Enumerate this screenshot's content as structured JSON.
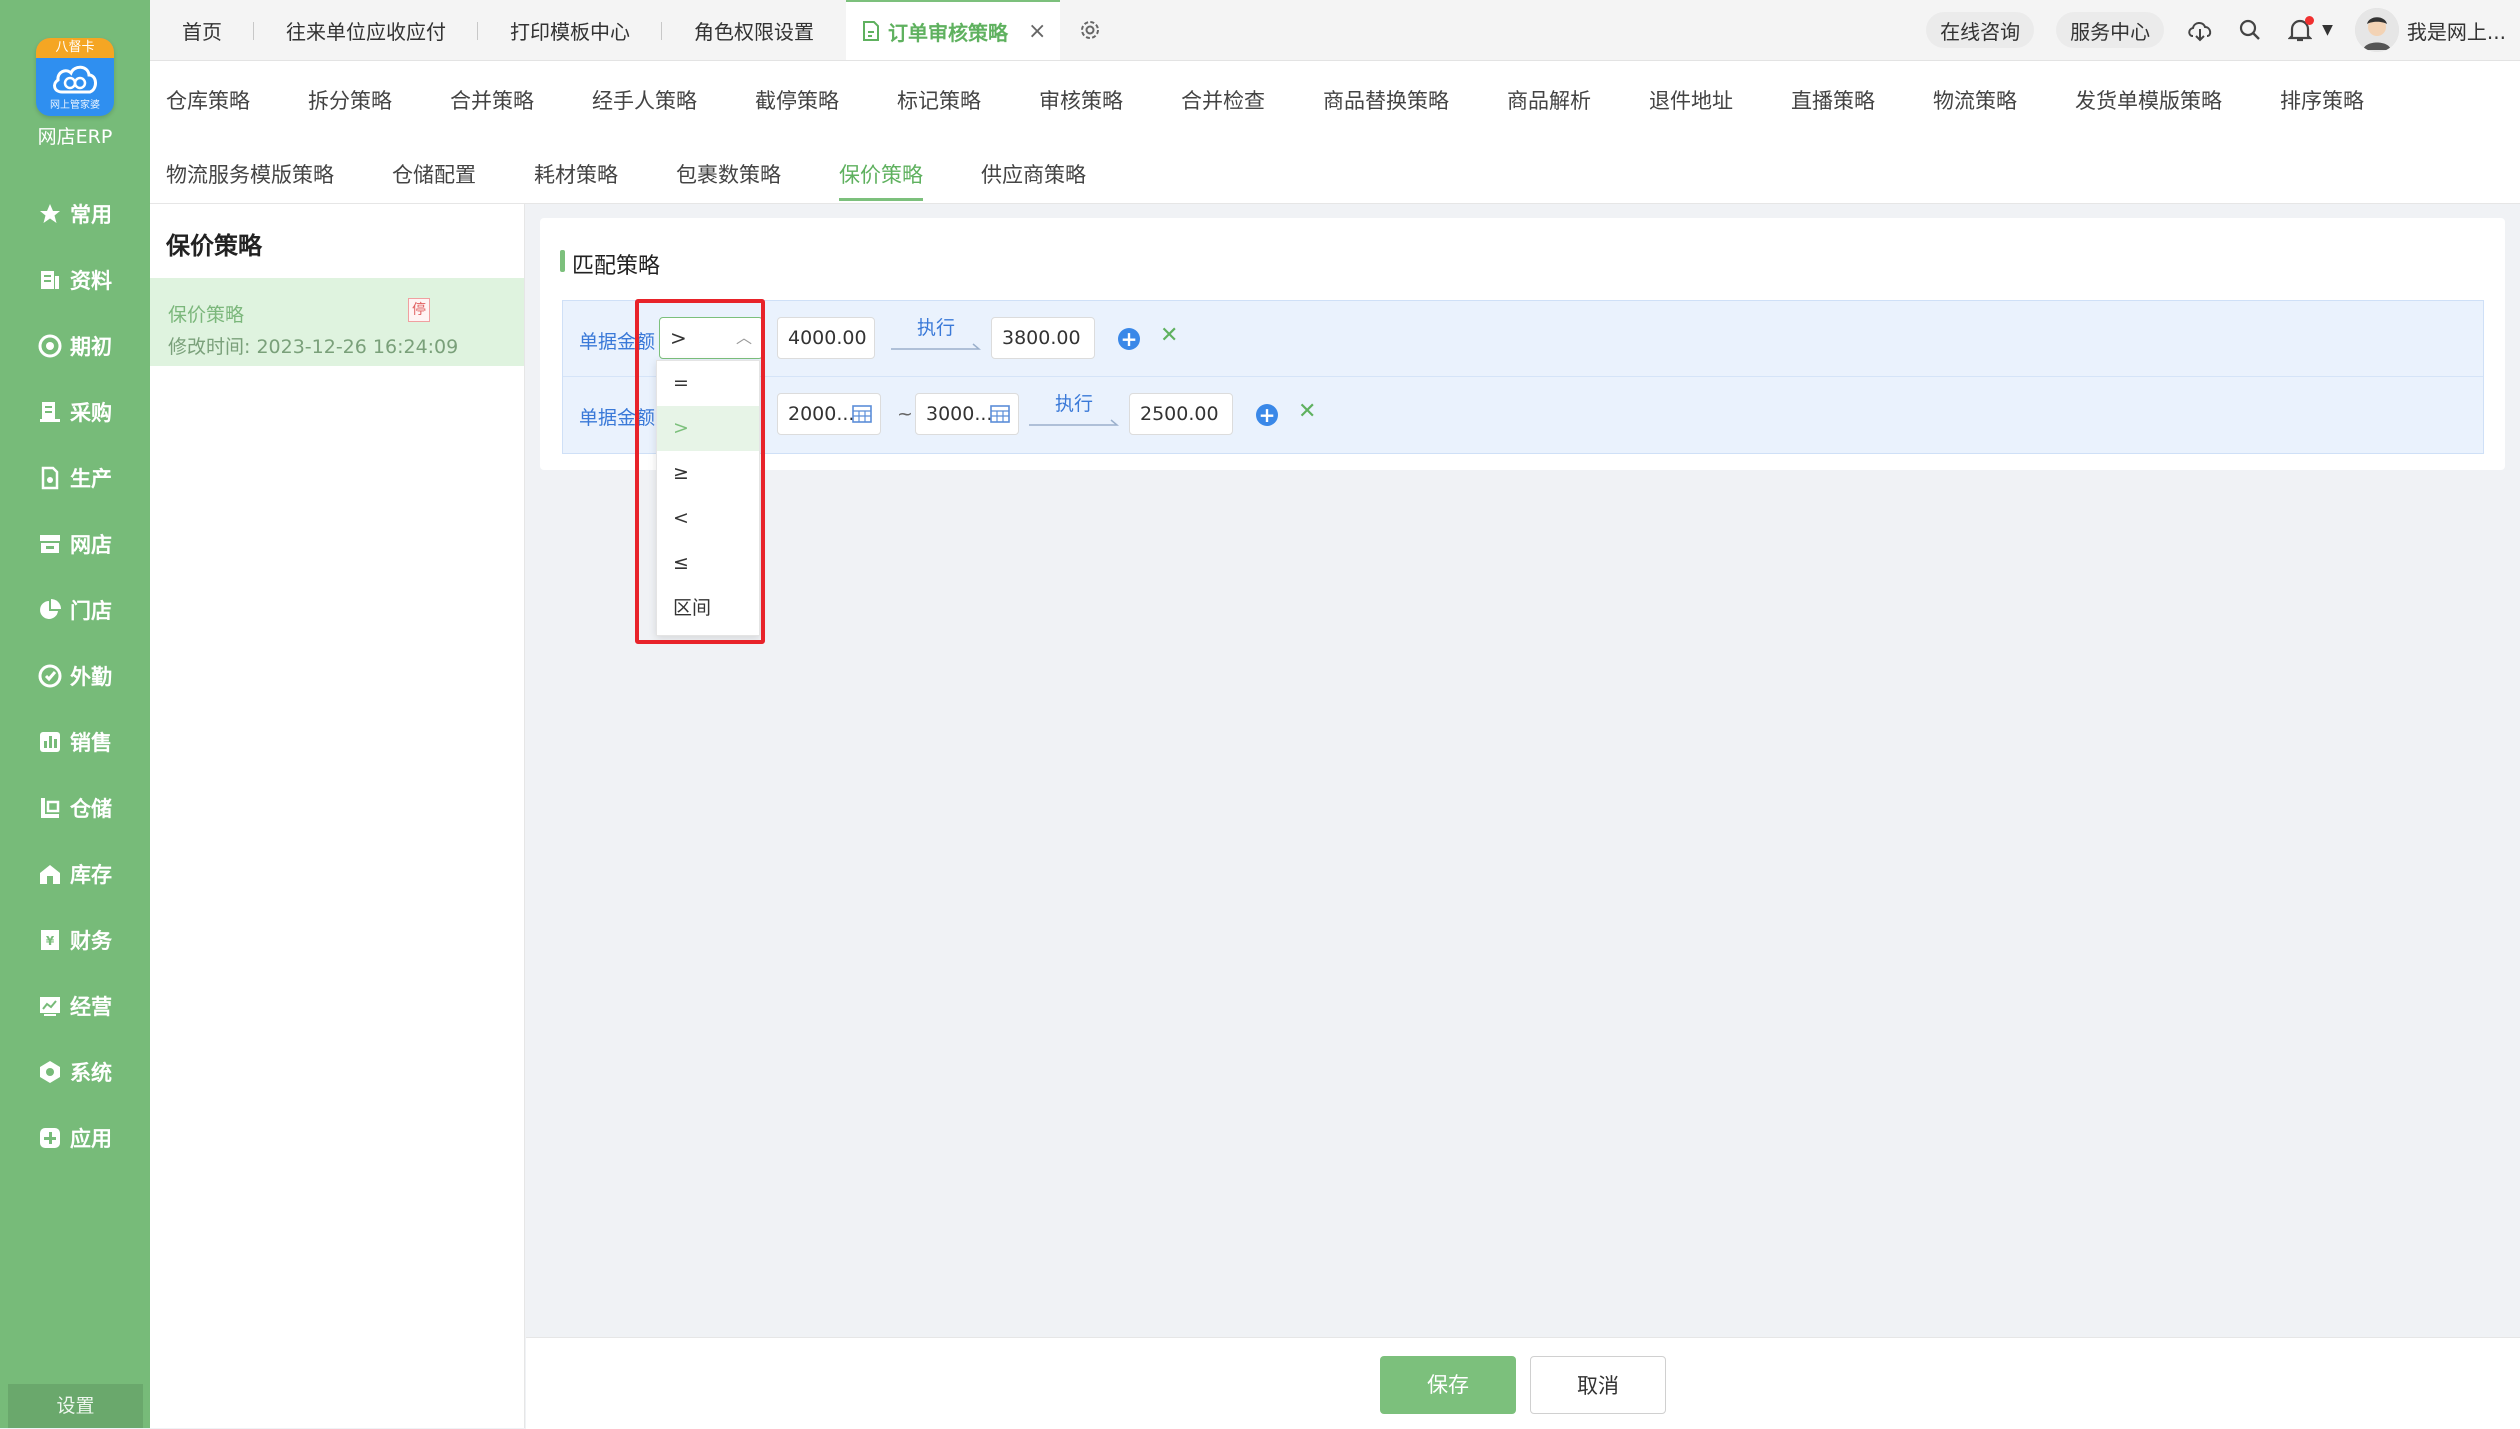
{
  "sidebar": {
    "logo_badge": "八督卡",
    "logo_sub": "网上管家婆",
    "app_name": "网店ERP",
    "items": [
      {
        "label": "常用",
        "icon": "star-icon"
      },
      {
        "label": "资料",
        "icon": "document-icon"
      },
      {
        "label": "期初",
        "icon": "target-icon"
      },
      {
        "label": "采购",
        "icon": "clipboard-icon"
      },
      {
        "label": "生产",
        "icon": "production-icon"
      },
      {
        "label": "网店",
        "icon": "store-icon"
      },
      {
        "label": "门店",
        "icon": "pie-icon"
      },
      {
        "label": "外勤",
        "icon": "field-icon"
      },
      {
        "label": "销售",
        "icon": "chart-icon"
      },
      {
        "label": "仓储",
        "icon": "warehouse-icon"
      },
      {
        "label": "库存",
        "icon": "inventory-icon"
      },
      {
        "label": "财务",
        "icon": "finance-icon"
      },
      {
        "label": "经营",
        "icon": "business-icon"
      },
      {
        "label": "系统",
        "icon": "system-icon"
      },
      {
        "label": "应用",
        "icon": "plus-app-icon"
      }
    ],
    "settings": "设置"
  },
  "topbar": {
    "tabs": [
      "首页",
      "往来单位应收应付",
      "打印模板中心",
      "角色权限设置"
    ],
    "active_tab": "订单审核策略",
    "online_consult": "在线咨询",
    "service_center": "服务中心",
    "user_name": "我是网上..."
  },
  "strategy_tabs": {
    "row1": [
      "仓库策略",
      "拆分策略",
      "合并策略",
      "经手人策略",
      "截停策略",
      "标记策略",
      "审核策略",
      "合并检查",
      "商品替换策略",
      "商品解析",
      "退件地址",
      "直播策略",
      "物流策略",
      "发货单模版策略",
      "排序策略"
    ],
    "row2": [
      "物流服务模版策略",
      "仓储配置",
      "耗材策略",
      "包裹数策略",
      "保价策略",
      "供应商策略"
    ],
    "active": "保价策略"
  },
  "list_panel": {
    "title": "保价策略",
    "items": [
      {
        "name": "保价策略",
        "time": "修改时间: 2023-12-26 16:24:09",
        "tag": "停"
      }
    ]
  },
  "main": {
    "section_title": "匹配策略",
    "rules": [
      {
        "label": "单据金额",
        "operator": ">",
        "value": "4000.00",
        "action": "执行",
        "result": "3800.00"
      },
      {
        "label": "单据金额",
        "from": "2000...",
        "to": "3000...",
        "action": "执行",
        "result": "2500.00"
      }
    ],
    "dropdown_options": [
      "=",
      ">",
      "≥",
      "<",
      "≤",
      "区间"
    ],
    "dropdown_selected": ">"
  },
  "footer": {
    "save": "保存",
    "cancel": "取消"
  },
  "colors": {
    "sidebar": "#77bb79",
    "accent": "#7cc07c",
    "link": "#3a79d8",
    "highlight": "#e8232a"
  }
}
